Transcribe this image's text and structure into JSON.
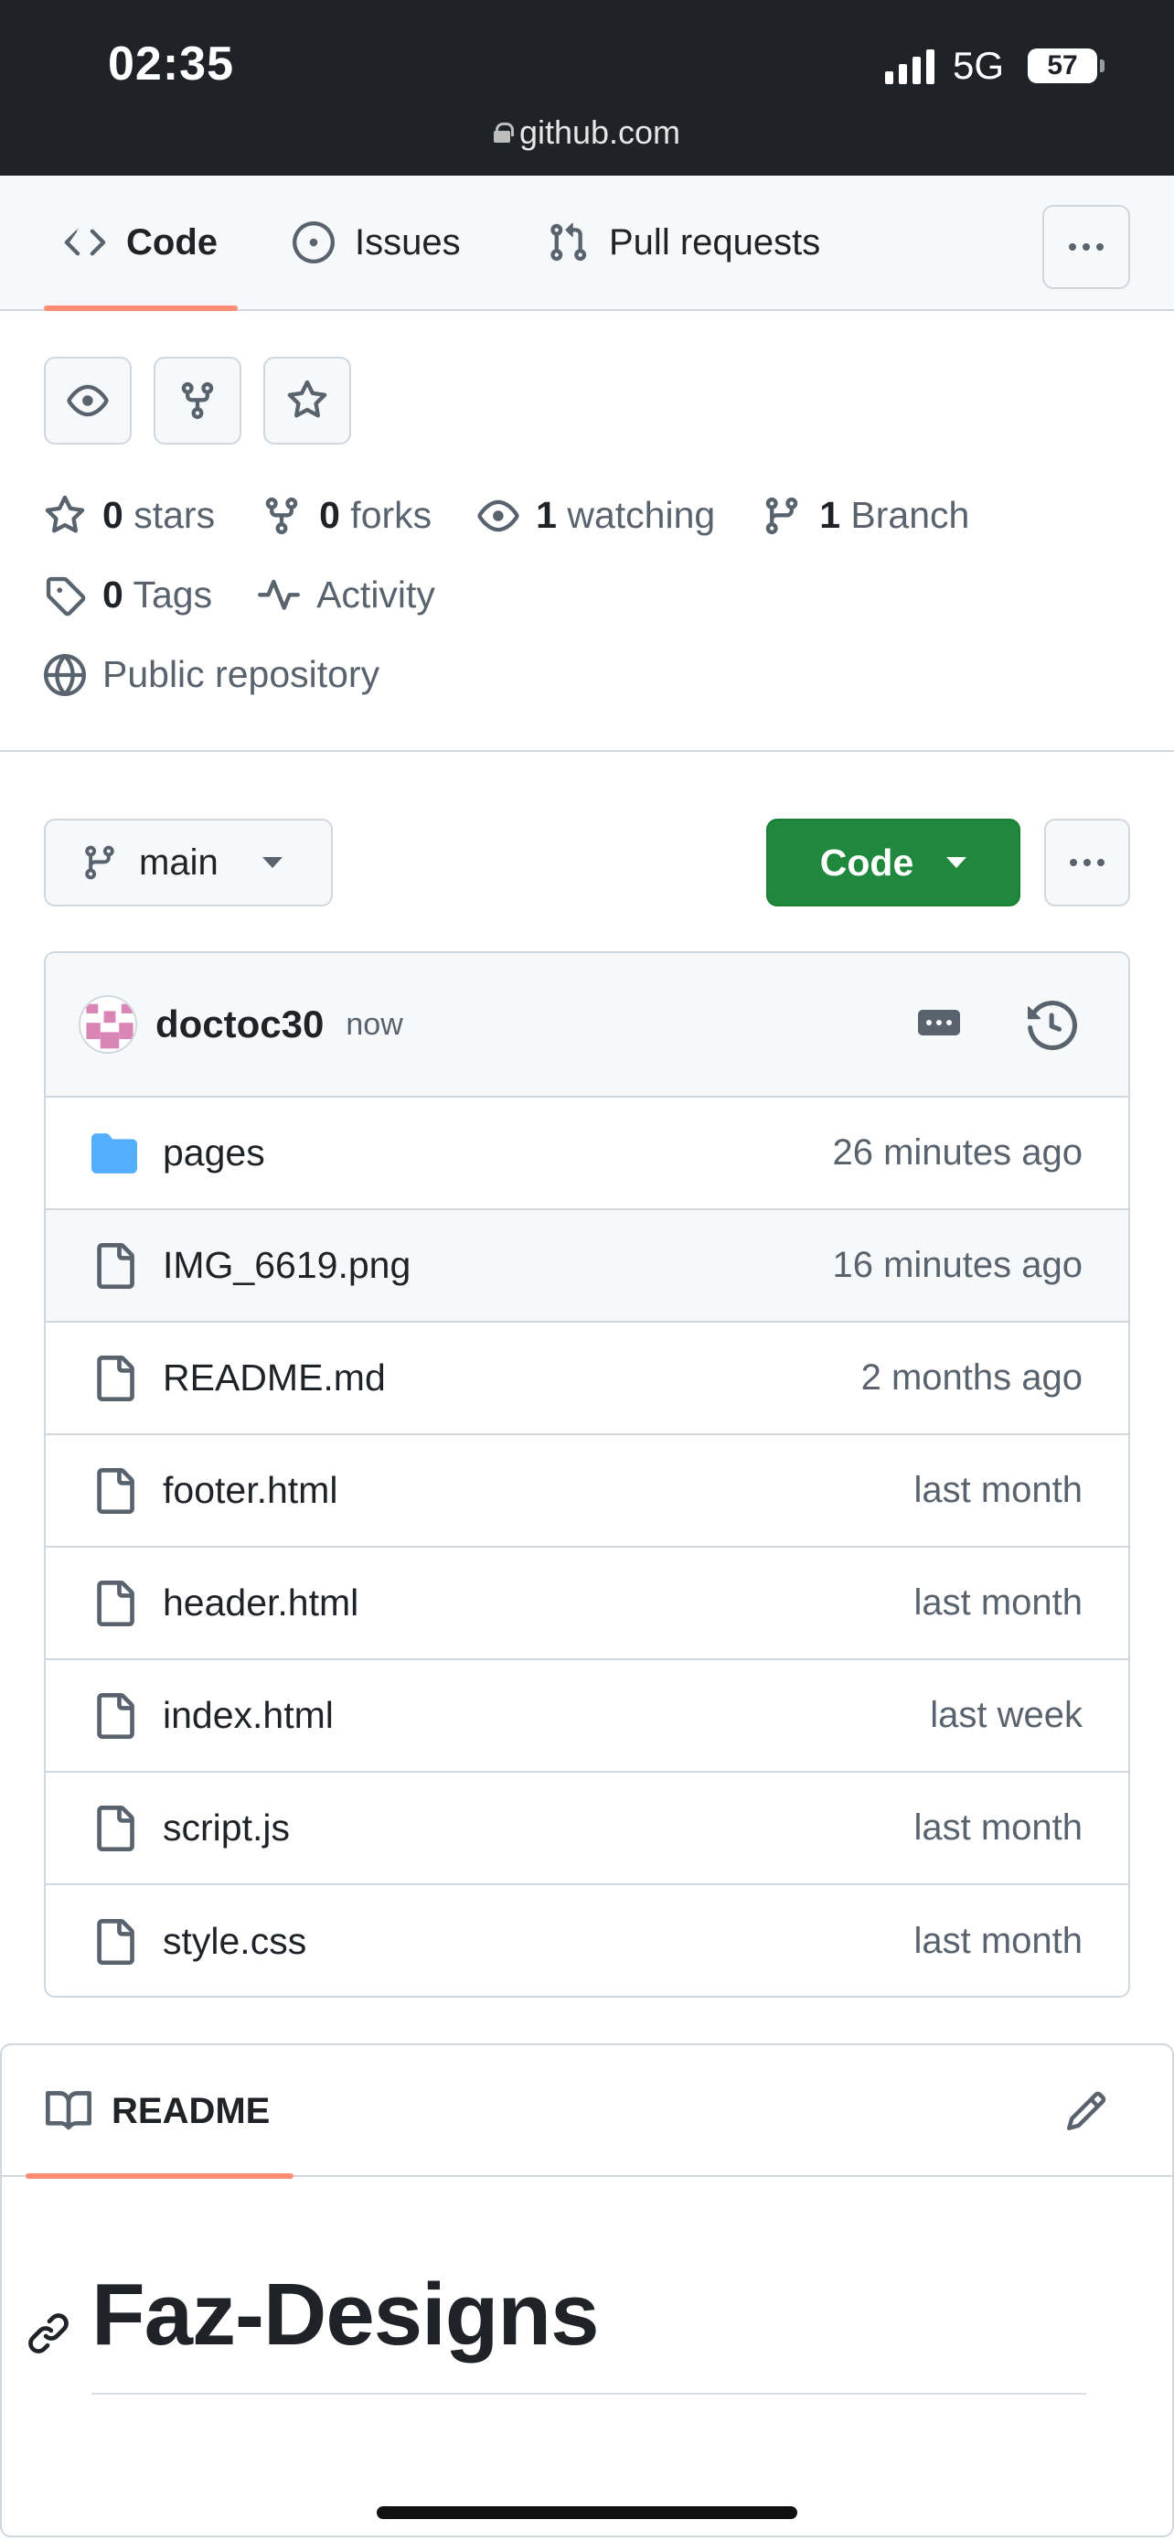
{
  "status_bar": {
    "time": "02:35",
    "network": "5G",
    "battery": "57",
    "url": "github.com"
  },
  "tabs": [
    {
      "label": "Code",
      "icon": "code-icon",
      "active": true
    },
    {
      "label": "Issues",
      "icon": "issue-opened-icon",
      "active": false
    },
    {
      "label": "Pull requests",
      "icon": "git-pull-request-icon",
      "active": false
    }
  ],
  "repo_meta": {
    "stars_count": "0",
    "stars_label": "stars",
    "forks_count": "0",
    "forks_label": "forks",
    "watching_count": "1",
    "watching_label": "watching",
    "branch_count": "1",
    "branch_label": "Branch",
    "tags_count": "0",
    "tags_label": "Tags",
    "activity_label": "Activity",
    "visibility_label": "Public repository"
  },
  "branch": {
    "name": "main"
  },
  "code_button": {
    "label": "Code"
  },
  "commit": {
    "author": "doctoc30",
    "time": "now"
  },
  "files": [
    {
      "name": "pages",
      "age": "26 minutes ago",
      "type": "folder"
    },
    {
      "name": "IMG_6619.png",
      "age": "16 minutes ago",
      "type": "file"
    },
    {
      "name": "README.md",
      "age": "2 months ago",
      "type": "file"
    },
    {
      "name": "footer.html",
      "age": "last month",
      "type": "file"
    },
    {
      "name": "header.html",
      "age": "last month",
      "type": "file"
    },
    {
      "name": "index.html",
      "age": "last week",
      "type": "file"
    },
    {
      "name": "script.js",
      "age": "last month",
      "type": "file"
    },
    {
      "name": "style.css",
      "age": "last month",
      "type": "file"
    }
  ],
  "readme": {
    "tab_label": "README",
    "heading": "Faz-Designs"
  },
  "colors": {
    "accent_underline": "#fd8c73",
    "code_button_green": "#1f883d",
    "folder_blue": "#54aeff"
  }
}
